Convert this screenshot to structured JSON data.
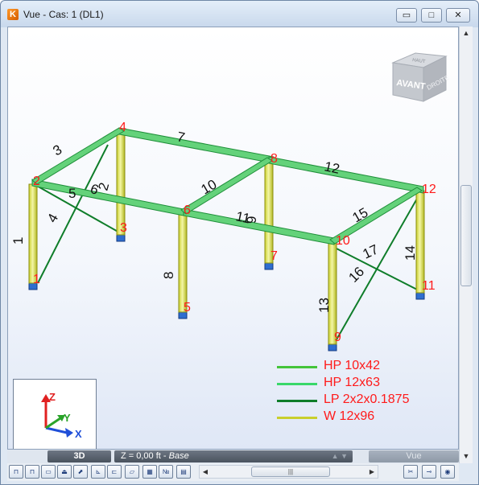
{
  "window": {
    "title": "Vue - Cas: 1 (DL1)",
    "app_icon_glyph": "K",
    "controls": {
      "minimize": "▭",
      "maximize": "□",
      "close": "✕"
    }
  },
  "viewport": {
    "nav_cube": {
      "front": "AVANT",
      "right": "DROITE",
      "top": "HAUT"
    },
    "nodes": [
      "1",
      "2",
      "3",
      "4",
      "5",
      "6",
      "7",
      "8",
      "9",
      "10",
      "11",
      "12"
    ],
    "members": [
      "1",
      "2",
      "3",
      "4",
      "5",
      "6",
      "7",
      "8",
      "9",
      "10",
      "11",
      "12",
      "13",
      "14",
      "15",
      "16",
      "17"
    ],
    "axes": {
      "z": "Z",
      "y": "Y",
      "x": "X"
    },
    "legend": [
      {
        "label": "HP 10x42",
        "color": "#44c43a"
      },
      {
        "label": "HP 12x63",
        "color": "#39d86a"
      },
      {
        "label": "LP 2x2x0.1875",
        "color": "#0f7d2a"
      },
      {
        "label": "W 12x96",
        "color": "#c9cf2c"
      }
    ]
  },
  "statusbar": {
    "mode": "3D",
    "level_prefix": "Z = 0,00 ft - ",
    "level_name": "Base",
    "view_label": "Vue"
  },
  "toolbar": {
    "hscroll_thumb": "|||"
  },
  "colors": {
    "node_label": "#ff1a1a",
    "member_label": "#111111",
    "column_fill": "#e7eb7e",
    "beam_fill": "#64d27a"
  }
}
